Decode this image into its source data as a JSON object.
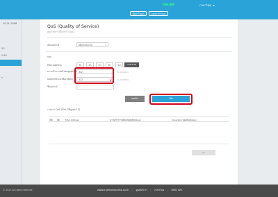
{
  "header": {
    "status": "ONLINE",
    "language": "ภาษาไทย",
    "setting_button": "ตั้งค่าโหมด",
    "logout_button": "ออกจากระบบ"
  },
  "sidebar": {
    "title": "10.3L 1308",
    "items": [
      "5G",
      "2.4G",
      "n",
      "",
      "",
      "",
      ""
    ]
  },
  "page": {
    "title": "QoS (Quality of Service)",
    "subtitle": "คุณภาพการให้บริการ (QoS)"
  },
  "form": {
    "device_label": "เลือกอุปกรณ์",
    "device_value": "เลือกโปรแกรม",
    "group_label": "กลุ่ม",
    "mac_label": "MAC Address",
    "duration_options": [
      "5s",
      "2h",
      "1h",
      "5h",
      "1d",
      "ระยะนาน"
    ],
    "duration_selected": "ระยะนาน",
    "upload_label": "ความเร็วการอัพโหลดสูงสุด(Kbps)",
    "upload_value": "312",
    "upload_hint": "(1-100000)",
    "download_label": "Downlink คงเหลือ(Kbps)",
    "download_value": "312",
    "download_hint": "(1-100000)",
    "name_label": "ชื่ออุปกรณ์",
    "cancel_button": "ยกเลิก",
    "add_button": "เพิ่ม"
  },
  "list": {
    "title": "รายการ QoS (ตั้งค่าได้สูงสุด 10)",
    "columns": [
      "เปิด",
      "ปิด",
      "MAC Address",
      "ความเร็วการอัพโหลดสูงสุด(Kbps)",
      "Downlink คงเหลือ(Kbps)"
    ],
    "delete_button": "ลบ"
  },
  "footer": {
    "copyright": "© 2023 All rights reserved",
    "links": [
      "www.truemoveonline.co.th",
      "ศูนย์บริการ",
      "ภาษาไทย",
      "OMG GPL"
    ]
  },
  "colors": {
    "accent": "#2aa3d8",
    "highlight": "#d4001a"
  }
}
